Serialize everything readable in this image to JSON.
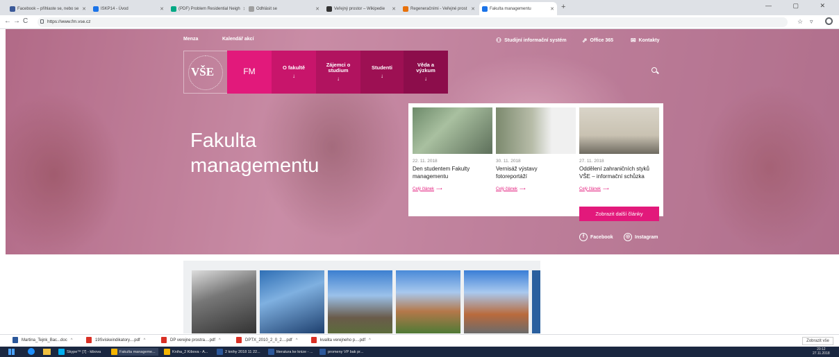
{
  "browser": {
    "tabs": [
      {
        "label": "Facebook – přihlaste se, nebo se",
        "color": "#3b5998"
      },
      {
        "label": "ISKP14 - Úvod",
        "color": "#1a73e8"
      },
      {
        "label": "(PDF) Problem Residential Neigh",
        "color": "#00a884"
      },
      {
        "label": "Odhlásit se",
        "color": "#9e9e9e"
      },
      {
        "label": "Veřejný prostor – Wikipedie",
        "color": "#333333"
      },
      {
        "label": "Regeneračními - Veřejné prost",
        "color": "#e8710a"
      },
      {
        "label": "Fakulta managementu",
        "color": "#1a73e8"
      }
    ],
    "new_tab": "+",
    "window_controls": "—  ▢  ✕",
    "back": "←",
    "forward": "→",
    "reload": "C",
    "url": "https://www.fm.vse.cz",
    "star": "☆",
    "ext": "▿"
  },
  "site": {
    "top_links": {
      "menza": "Menza",
      "kalendar": "Kalendář akcí",
      "sis": "Studijní informační systém",
      "office": "Office 365",
      "kontakty": "Kontakty"
    },
    "logo_text": "VŠE",
    "menu": {
      "fm": "FM",
      "fakulta": "O fakultě",
      "zajemci_1": "Zájemci o",
      "zajemci_2": "studium",
      "studenti": "Studenti",
      "veda_1": "Věda a",
      "veda_2": "výzkum",
      "arrow": "↓"
    },
    "hero_title_1": "Fakulta",
    "hero_title_2": "managementu",
    "news": [
      {
        "date": "22. 11. 2018",
        "title_1": "Den studentem Fakulty",
        "title_2": "managementu",
        "link": "Celý článek"
      },
      {
        "date": "30. 11. 2018",
        "title_1": "Vernisáž výstavy",
        "title_2": "fotoreportáží",
        "link": "Celý článek"
      },
      {
        "date": "27. 11. 2018",
        "title_1": "Oddělení zahraničních styků",
        "title_2": "VŠE – informační schůzka",
        "link": "Celý článek"
      }
    ],
    "link_arrow": "⟶",
    "more_button": "Zobrazit další články",
    "social": {
      "facebook": "Facebook",
      "instagram": "Instagram"
    }
  },
  "downloads": {
    "items": [
      "Martina_Tejnk_Bac...doc",
      "19Sviskeindikatory....pdf",
      "DP verejne prostra....pdf",
      "DPTX_2010_2_0_2....pdf",
      "kvalita verejneho p....pdf"
    ],
    "show_all": "Zobrazit vše"
  },
  "taskbar": {
    "items": [
      "Skype™ [7] - kibova",
      "Fakulta manageme...",
      "Kniha_2 Kibova - A...",
      "2 knihy 2018 11 22...",
      "literatura ke knize - ...",
      "promeny VP bak pr..."
    ],
    "time": "20:12",
    "date": "27.11.2018"
  }
}
